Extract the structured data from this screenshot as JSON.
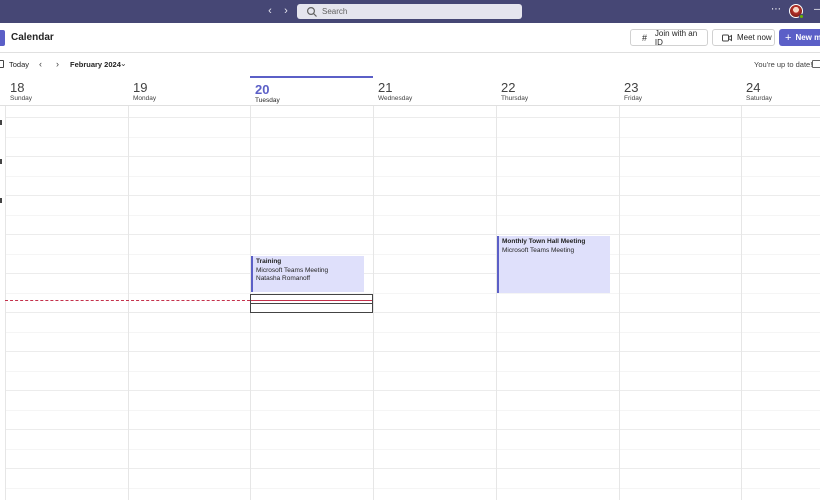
{
  "topbar": {
    "search_placeholder": "Search",
    "back_icon": "chevron-left-icon",
    "forward_icon": "chevron-right-icon",
    "more_icon": "ellipsis-icon",
    "avatar_icon": "user-avatar"
  },
  "header": {
    "title": "Calendar",
    "join_label": "Join with an ID",
    "meet_label": "Meet now",
    "new_label": "New m"
  },
  "toolbar": {
    "today_label": "Today",
    "month_label": "February 2024",
    "status_text": "You're up to date!"
  },
  "days": [
    {
      "num": "18",
      "name": "Sunday"
    },
    {
      "num": "19",
      "name": "Monday"
    },
    {
      "num": "20",
      "name": "Tuesday"
    },
    {
      "num": "21",
      "name": "Wednesday"
    },
    {
      "num": "22",
      "name": "Thursday"
    },
    {
      "num": "23",
      "name": "Friday"
    },
    {
      "num": "24",
      "name": "Saturday"
    }
  ],
  "events": [
    {
      "title": "Training",
      "line2": "Microsoft Teams Meeting",
      "line3": "Natasha Romanoff"
    },
    {
      "title": "Monthly Town Hall Meeting",
      "line2": "Microsoft Teams Meeting",
      "line3": ""
    }
  ],
  "colors": {
    "topbar": "#464775",
    "accent": "#5b5fc7",
    "event_bg": "#dfe0fb",
    "now_line": "#c4314b"
  }
}
